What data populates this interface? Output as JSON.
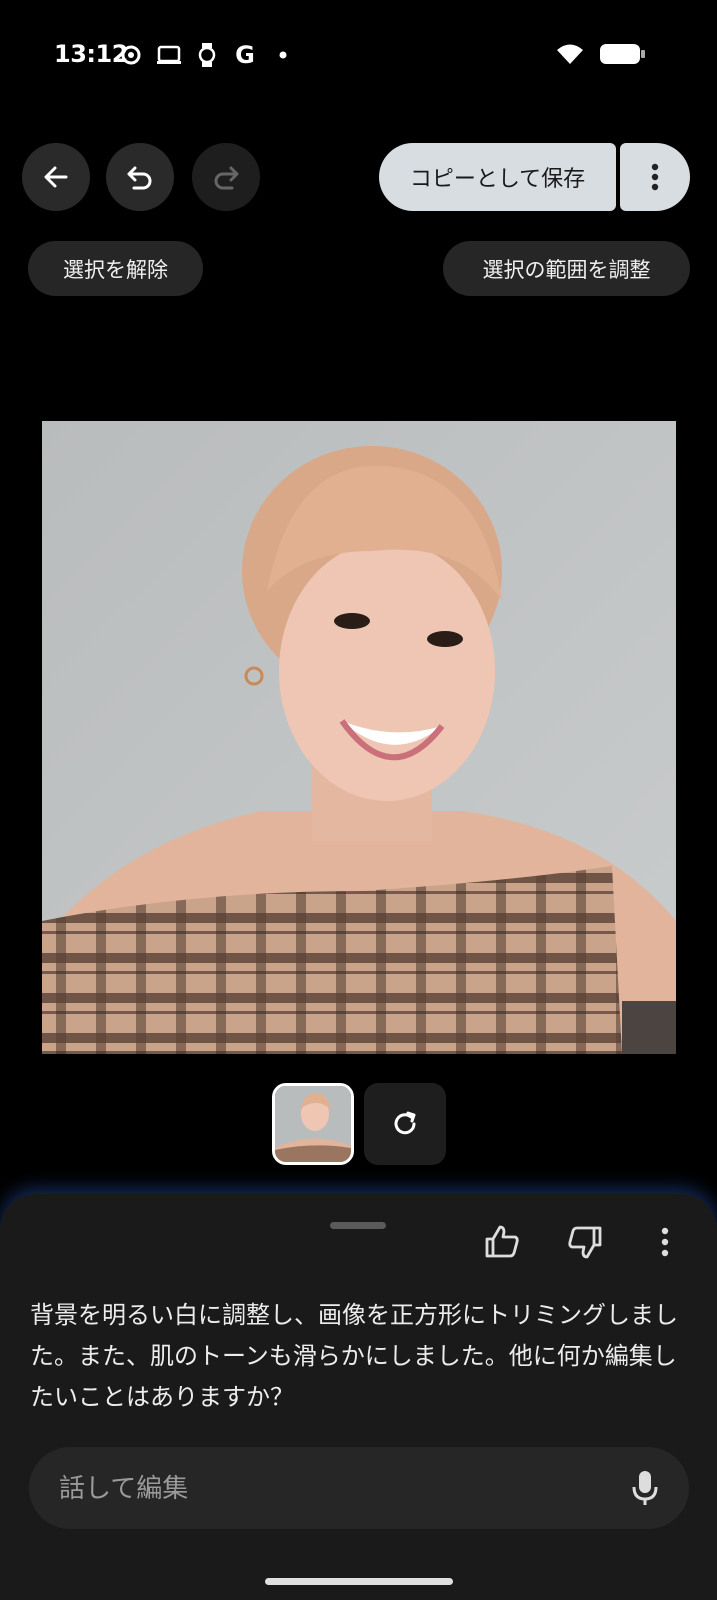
{
  "status_bar": {
    "time": "13:12",
    "left_icons": [
      "sync-icon",
      "cast-icon",
      "watch-icon",
      "google-icon",
      "dot-icon"
    ],
    "right_icons": [
      "wifi-icon",
      "battery-icon"
    ]
  },
  "toolbar": {
    "back_icon": "arrow-back-icon",
    "undo_icon": "undo-icon",
    "redo_icon": "redo-icon",
    "save_label": "コピーとして保存",
    "more_icon": "more-vert-icon"
  },
  "selection": {
    "deselect_label": "選択を解除",
    "adjust_label": "選択の範囲を調整"
  },
  "thumbnails": {
    "regenerate_icon": "refresh-icon"
  },
  "sheet": {
    "message": "背景を明るい白に調整し、画像を正方形にトリミングしました。また、肌のトーンも滑らかにしました。他に何か編集したいことはありますか？",
    "input_placeholder": "話して編集",
    "mic_icon": "mic-icon",
    "like_icon": "thumb-up-icon",
    "dislike_icon": "thumb-down-icon"
  },
  "colors": {
    "background": "#000000",
    "sheet": "#1a1a1a",
    "save_button": "#d8dde2",
    "glow": "#3c78ff"
  }
}
